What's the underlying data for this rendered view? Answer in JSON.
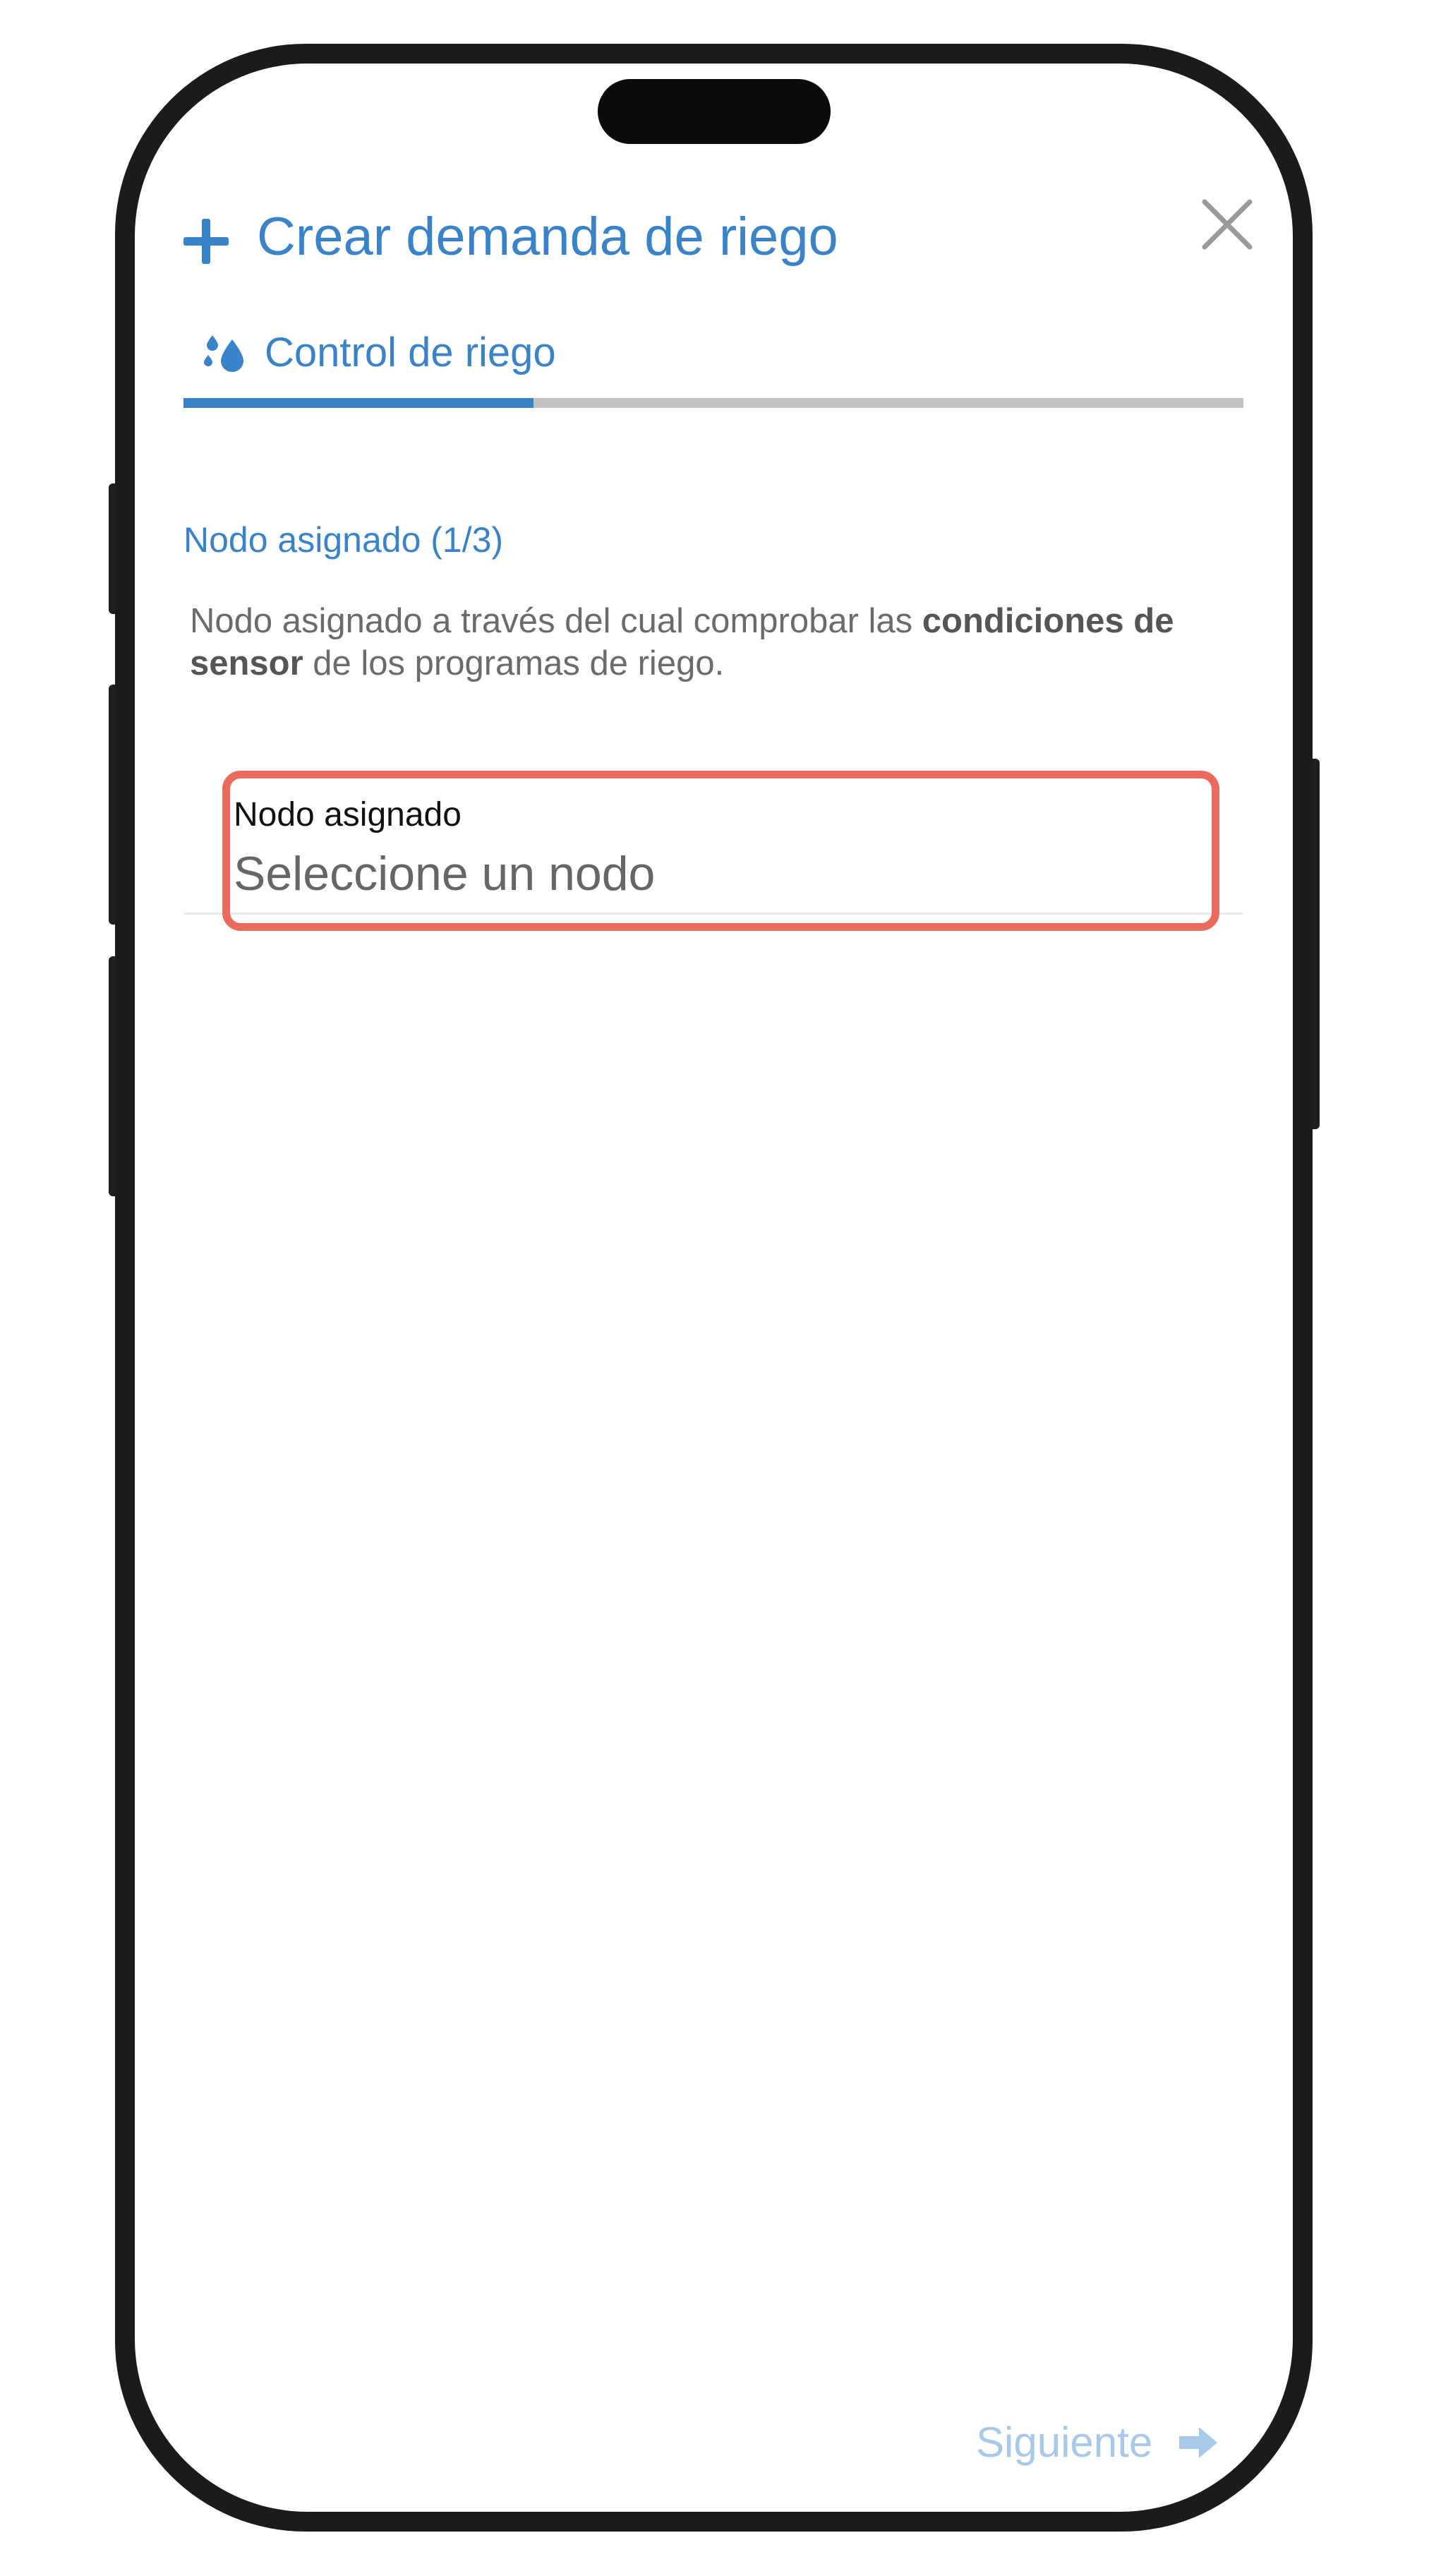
{
  "dialog": {
    "title": "Crear demanda de riego",
    "tab_label": "Control de riego",
    "progress": 0.33
  },
  "step": {
    "title": "Nodo asignado (1/3)",
    "description_part1": "Nodo asignado a través del cual comprobar las ",
    "description_bold1": "condiciones de",
    "description_bold2": "sensor",
    "description_part2": " de los programas de riego."
  },
  "node_field": {
    "label": "Nodo asignado",
    "placeholder": "Seleccione un nodo"
  },
  "footer": {
    "next_label": "Siguiente"
  },
  "colors": {
    "accent": "#3a83c8",
    "highlight": "#ea6a5b",
    "disabled": "#a9c9e9"
  },
  "icons": {
    "create": "plus-icon",
    "close": "close-icon",
    "tab": "water-drops-icon",
    "next": "arrow-right-icon"
  }
}
